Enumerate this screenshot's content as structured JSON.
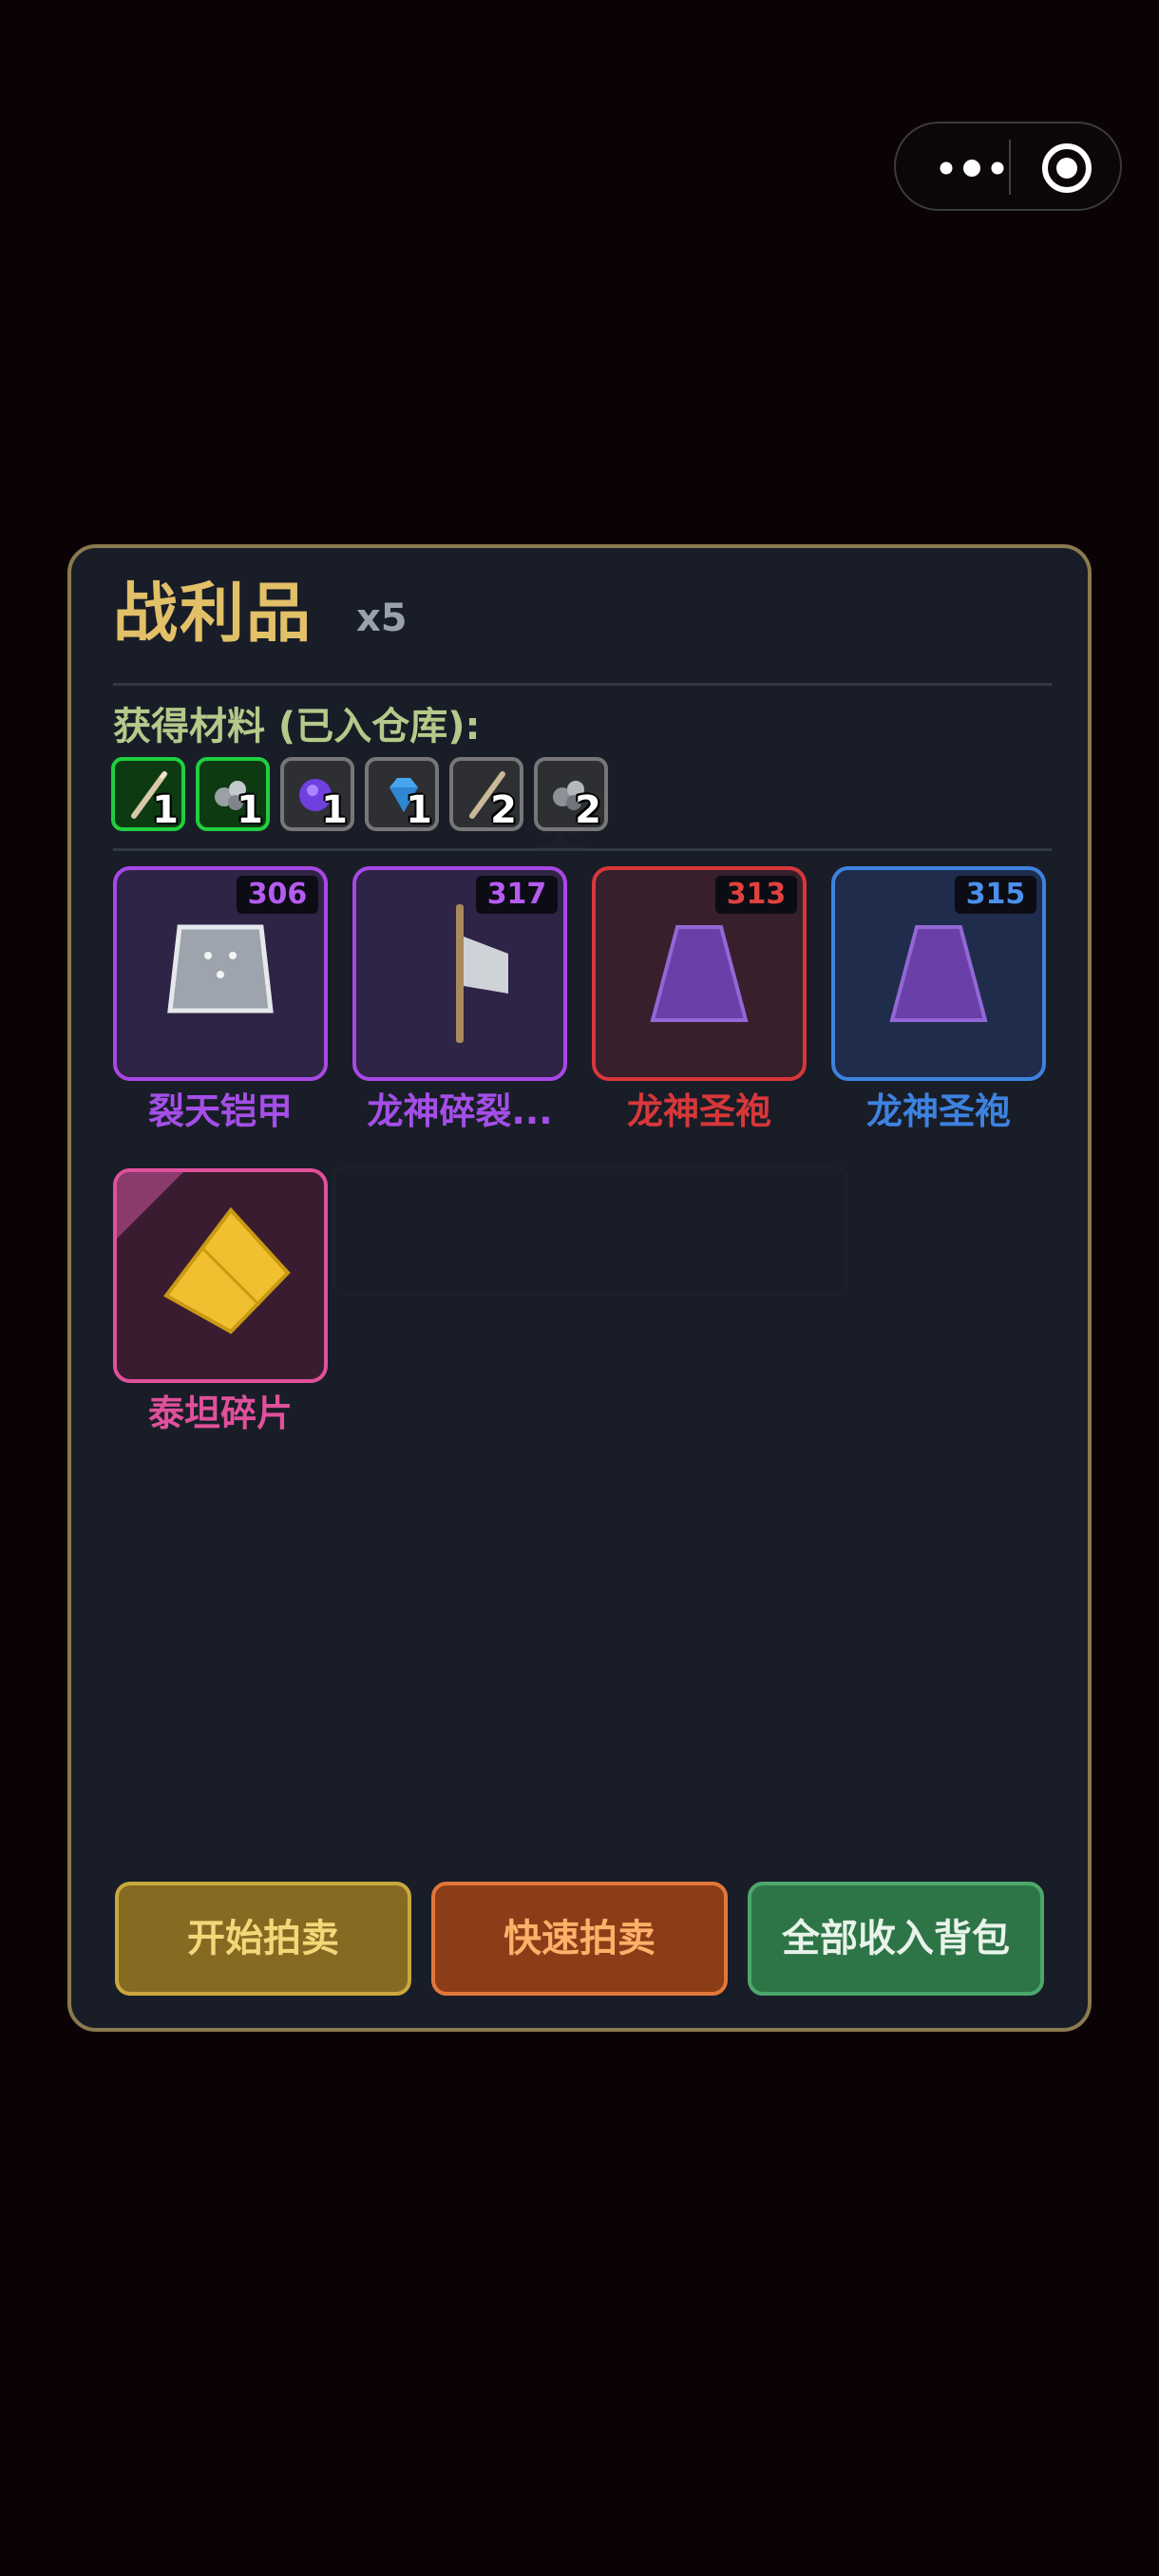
{
  "capsule": {
    "more_icon": "more-dots-icon",
    "close_icon": "target-circle-icon"
  },
  "panel": {
    "title": "战利品",
    "count": "x5",
    "materials_label": "获得材料 (已入仓库):",
    "materials": [
      {
        "icon": "feather-quill-icon",
        "quantity": "1",
        "rarity": "green"
      },
      {
        "icon": "ore-rocks-icon",
        "quantity": "1",
        "rarity": "green"
      },
      {
        "icon": "purple-orb-icon",
        "quantity": "1",
        "rarity": "gray"
      },
      {
        "icon": "blue-crystal-icon",
        "quantity": "1",
        "rarity": "gray"
      },
      {
        "icon": "feather-quill-icon",
        "quantity": "2",
        "rarity": "gray"
      },
      {
        "icon": "ore-rocks-icon",
        "quantity": "2",
        "rarity": "gray"
      }
    ],
    "items": [
      {
        "name": "裂天铠甲",
        "level": "306",
        "icon": "armor-chestplate-icon",
        "color": "#a44ee8"
      },
      {
        "name": "龙神碎裂...",
        "level": "317",
        "icon": "battle-axe-icon",
        "color": "#a44ee8"
      },
      {
        "name": "龙神圣袍",
        "level": "313",
        "icon": "robe-icon",
        "color": "#d8373a"
      },
      {
        "name": "龙神圣袍",
        "level": "315",
        "icon": "robe-icon",
        "color": "#3d82e0"
      },
      {
        "name": "泰坦碎片",
        "level": "",
        "icon": "golden-shard-icon",
        "color": "#e0509c"
      }
    ],
    "buttons": {
      "auction": "开始拍卖",
      "quick_auction": "快速拍卖",
      "collect_all": "全部收入背包"
    }
  }
}
